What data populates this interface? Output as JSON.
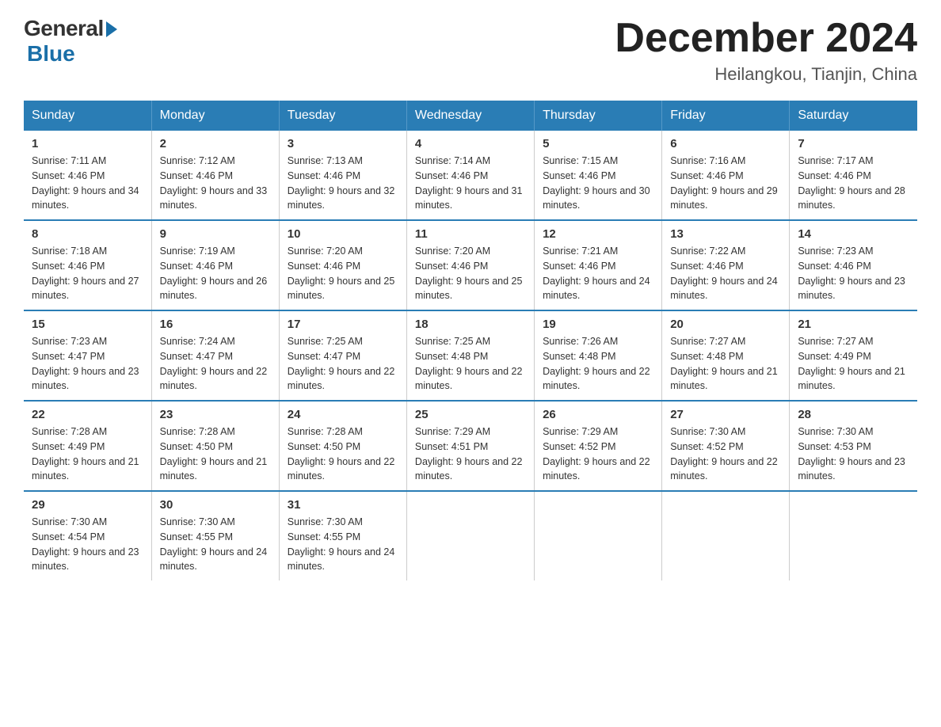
{
  "logo": {
    "general": "General",
    "blue": "Blue"
  },
  "title": {
    "month_year": "December 2024",
    "location": "Heilangkou, Tianjin, China"
  },
  "days_of_week": [
    "Sunday",
    "Monday",
    "Tuesday",
    "Wednesday",
    "Thursday",
    "Friday",
    "Saturday"
  ],
  "weeks": [
    [
      {
        "day": 1,
        "sunrise": "7:11 AM",
        "sunset": "4:46 PM",
        "daylight": "9 hours and 34 minutes."
      },
      {
        "day": 2,
        "sunrise": "7:12 AM",
        "sunset": "4:46 PM",
        "daylight": "9 hours and 33 minutes."
      },
      {
        "day": 3,
        "sunrise": "7:13 AM",
        "sunset": "4:46 PM",
        "daylight": "9 hours and 32 minutes."
      },
      {
        "day": 4,
        "sunrise": "7:14 AM",
        "sunset": "4:46 PM",
        "daylight": "9 hours and 31 minutes."
      },
      {
        "day": 5,
        "sunrise": "7:15 AM",
        "sunset": "4:46 PM",
        "daylight": "9 hours and 30 minutes."
      },
      {
        "day": 6,
        "sunrise": "7:16 AM",
        "sunset": "4:46 PM",
        "daylight": "9 hours and 29 minutes."
      },
      {
        "day": 7,
        "sunrise": "7:17 AM",
        "sunset": "4:46 PM",
        "daylight": "9 hours and 28 minutes."
      }
    ],
    [
      {
        "day": 8,
        "sunrise": "7:18 AM",
        "sunset": "4:46 PM",
        "daylight": "9 hours and 27 minutes."
      },
      {
        "day": 9,
        "sunrise": "7:19 AM",
        "sunset": "4:46 PM",
        "daylight": "9 hours and 26 minutes."
      },
      {
        "day": 10,
        "sunrise": "7:20 AM",
        "sunset": "4:46 PM",
        "daylight": "9 hours and 25 minutes."
      },
      {
        "day": 11,
        "sunrise": "7:20 AM",
        "sunset": "4:46 PM",
        "daylight": "9 hours and 25 minutes."
      },
      {
        "day": 12,
        "sunrise": "7:21 AM",
        "sunset": "4:46 PM",
        "daylight": "9 hours and 24 minutes."
      },
      {
        "day": 13,
        "sunrise": "7:22 AM",
        "sunset": "4:46 PM",
        "daylight": "9 hours and 24 minutes."
      },
      {
        "day": 14,
        "sunrise": "7:23 AM",
        "sunset": "4:46 PM",
        "daylight": "9 hours and 23 minutes."
      }
    ],
    [
      {
        "day": 15,
        "sunrise": "7:23 AM",
        "sunset": "4:47 PM",
        "daylight": "9 hours and 23 minutes."
      },
      {
        "day": 16,
        "sunrise": "7:24 AM",
        "sunset": "4:47 PM",
        "daylight": "9 hours and 22 minutes."
      },
      {
        "day": 17,
        "sunrise": "7:25 AM",
        "sunset": "4:47 PM",
        "daylight": "9 hours and 22 minutes."
      },
      {
        "day": 18,
        "sunrise": "7:25 AM",
        "sunset": "4:48 PM",
        "daylight": "9 hours and 22 minutes."
      },
      {
        "day": 19,
        "sunrise": "7:26 AM",
        "sunset": "4:48 PM",
        "daylight": "9 hours and 22 minutes."
      },
      {
        "day": 20,
        "sunrise": "7:27 AM",
        "sunset": "4:48 PM",
        "daylight": "9 hours and 21 minutes."
      },
      {
        "day": 21,
        "sunrise": "7:27 AM",
        "sunset": "4:49 PM",
        "daylight": "9 hours and 21 minutes."
      }
    ],
    [
      {
        "day": 22,
        "sunrise": "7:28 AM",
        "sunset": "4:49 PM",
        "daylight": "9 hours and 21 minutes."
      },
      {
        "day": 23,
        "sunrise": "7:28 AM",
        "sunset": "4:50 PM",
        "daylight": "9 hours and 21 minutes."
      },
      {
        "day": 24,
        "sunrise": "7:28 AM",
        "sunset": "4:50 PM",
        "daylight": "9 hours and 22 minutes."
      },
      {
        "day": 25,
        "sunrise": "7:29 AM",
        "sunset": "4:51 PM",
        "daylight": "9 hours and 22 minutes."
      },
      {
        "day": 26,
        "sunrise": "7:29 AM",
        "sunset": "4:52 PM",
        "daylight": "9 hours and 22 minutes."
      },
      {
        "day": 27,
        "sunrise": "7:30 AM",
        "sunset": "4:52 PM",
        "daylight": "9 hours and 22 minutes."
      },
      {
        "day": 28,
        "sunrise": "7:30 AM",
        "sunset": "4:53 PM",
        "daylight": "9 hours and 23 minutes."
      }
    ],
    [
      {
        "day": 29,
        "sunrise": "7:30 AM",
        "sunset": "4:54 PM",
        "daylight": "9 hours and 23 minutes."
      },
      {
        "day": 30,
        "sunrise": "7:30 AM",
        "sunset": "4:55 PM",
        "daylight": "9 hours and 24 minutes."
      },
      {
        "day": 31,
        "sunrise": "7:30 AM",
        "sunset": "4:55 PM",
        "daylight": "9 hours and 24 minutes."
      },
      null,
      null,
      null,
      null
    ]
  ]
}
